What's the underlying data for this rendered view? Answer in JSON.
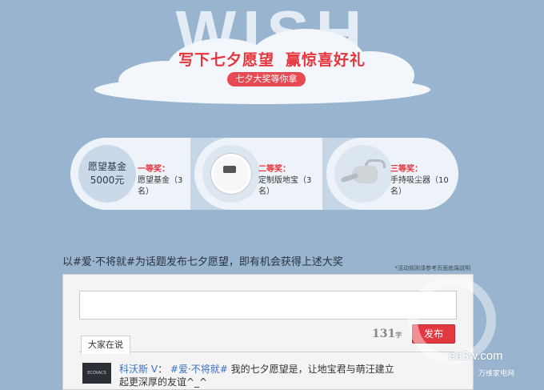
{
  "hero": {
    "wordmark": "WISH",
    "title_left": "写下七夕愿望",
    "title_right": "赢惊喜好礼",
    "pill": "七夕大奖等你拿"
  },
  "prizes": [
    {
      "medal_line1": "愿望基金",
      "medal_line2": "5000元",
      "rank": "一等奖：",
      "desc": "愿望基金（3名）"
    },
    {
      "rank": "二等奖：",
      "desc": "定制版地宝（3名）",
      "icon": "robot-vacuum-icon"
    },
    {
      "rank": "三等奖：",
      "desc": "手持吸尘器（10名）",
      "icon": "handheld-vacuum-icon"
    }
  ],
  "intro": "以#爱·不将就#为话题发布七夕愿望，即有机会获得上述大奖",
  "note": "*活动规则请参考页面底端说明",
  "composer": {
    "input_value": "",
    "counter": "131",
    "counter_unit": "字",
    "publish_label": "发布"
  },
  "feed": {
    "tab_label": "大家在说",
    "posts": [
      {
        "avatar_text": "ECOVACS",
        "author": "科沃斯",
        "verify": "V",
        "sep": "：",
        "tag": "#爱·不将就#",
        "text_line1": "我的七夕愿望是，让地宝君与萌汪建立",
        "text_line2": "起更深厚的友谊^_^"
      }
    ]
  },
  "watermark": {
    "brand": "ea3w.com",
    "sub": "万维家电网"
  },
  "colors": {
    "accent_red": "#e23840",
    "background": "#98b4cf",
    "link_blue": "#3b70c0"
  }
}
